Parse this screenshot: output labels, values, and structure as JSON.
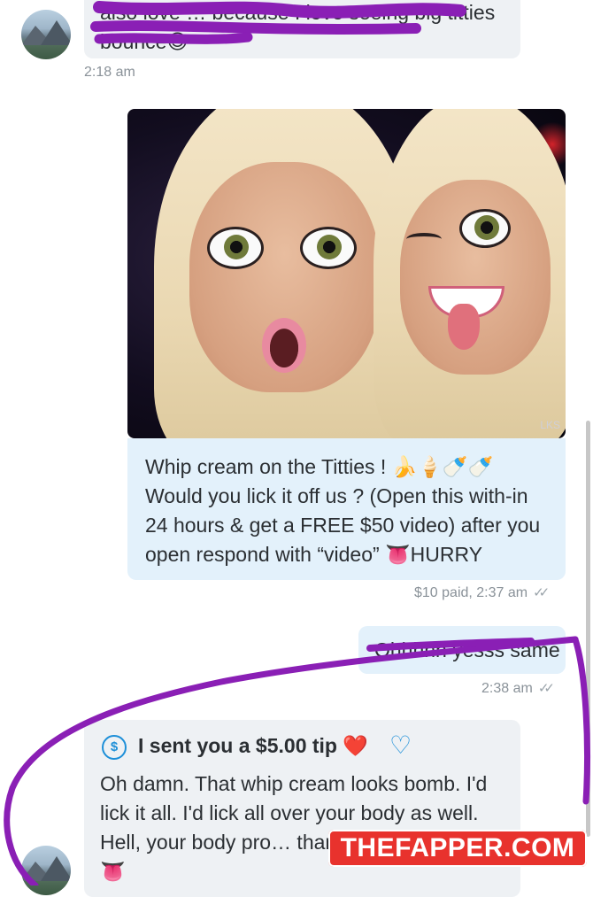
{
  "top_message": {
    "text": "also love … because I love seeing big titties bounce😊",
    "time": "2:18 am"
  },
  "media_message": {
    "corner_label": "LKS",
    "caption": "Whip cream on the Titties ! 🍌🍦🍼🍼 Would you lick it off us ? (Open this with-in 24 hours & get a FREE $50 video) after you open respond with “video” 👅HURRY",
    "status": "$10 paid, 2:37 am",
    "ticks": "✓✓"
  },
  "reply_out": {
    "text": "Ohhhhh yesss same",
    "time": "2:38 am",
    "ticks": "✓✓"
  },
  "tip_message": {
    "tip_icon": "$",
    "tip_label": "I sent you a $5.00 tip ❤️",
    "tip_heart_outline": "♡",
    "text": "Oh damn. That whip cream looks bomb. I'd lick it all. I'd lick all over your body as well. Hell, your body pro… than the whip cream🤤👅"
  },
  "watermark": "THEFAPPER.COM",
  "colors": {
    "incoming_bubble": "#eef1f4",
    "outgoing_bubble": "#e3f1fb",
    "accent_blue": "#1d8fd8",
    "scribble_purple": "#8a1fb5",
    "watermark_red": "#e8322d"
  }
}
